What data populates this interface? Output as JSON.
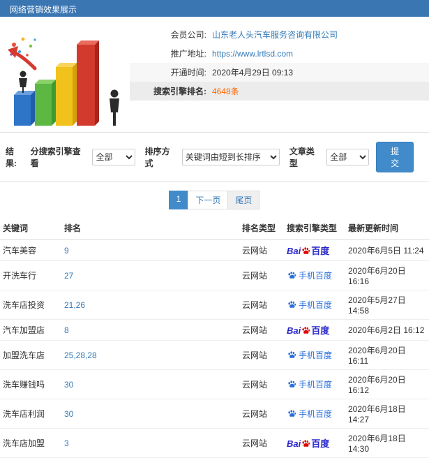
{
  "colors": {
    "titlebar_bg": "#3a76b2",
    "accent": "#428bca",
    "link": "#337ab7",
    "highlight": "#ff6600",
    "baidu_blue": "#2826c9",
    "baidu_red": "#e10602",
    "mobile_baidu_blue": "#2a6fdb"
  },
  "header": {
    "title": "网络营销效果展示"
  },
  "info": {
    "rows": [
      {
        "label": "会员公司:",
        "value": "山东老人头汽车服务咨询有限公司"
      },
      {
        "label": "推广地址:",
        "value": "https://www.lrtlsd.com"
      },
      {
        "label": "开通时间:",
        "value": "2020年4月29日 09:13"
      },
      {
        "label": "搜索引擎排名:",
        "value": "4648条"
      }
    ]
  },
  "filters": {
    "section_label": "结果:",
    "engine_label": "分搜索引擎查看",
    "engine_value": "全部",
    "sort_label": "排序方式",
    "sort_value": "关键词由短到长排序",
    "article_label": "文章类型",
    "article_value": "全部",
    "submit_label": "提交"
  },
  "pagination": {
    "current": "1",
    "next": "下一页",
    "last": "尾页"
  },
  "table": {
    "headers": [
      "关键词",
      "排名",
      "排名类型",
      "搜索引擎类型",
      "最新更新时间"
    ],
    "engine_labels": {
      "baidu_bai": "Bai",
      "baidu_du": "百度",
      "mobile_baidu": "手机百度"
    },
    "rows": [
      {
        "keyword": "汽车美容",
        "rank": "9",
        "rank_type": "云网站",
        "engine": "baidu",
        "updated": "2020年6月5日 11:24"
      },
      {
        "keyword": "开洗车行",
        "rank": "27",
        "rank_type": "云网站",
        "engine": "mobile-baidu",
        "updated": "2020年6月20日 16:16"
      },
      {
        "keyword": "洗车店投资",
        "rank": "21,26",
        "rank_type": "云网站",
        "engine": "mobile-baidu",
        "updated": "2020年5月27日 14:58"
      },
      {
        "keyword": "汽车加盟店",
        "rank": "8",
        "rank_type": "云网站",
        "engine": "baidu",
        "updated": "2020年6月2日 16:12"
      },
      {
        "keyword": "加盟洗车店",
        "rank": "25,28,28",
        "rank_type": "云网站",
        "engine": "mobile-baidu",
        "updated": "2020年6月20日 16:11"
      },
      {
        "keyword": "洗车赚钱吗",
        "rank": "30",
        "rank_type": "云网站",
        "engine": "mobile-baidu",
        "updated": "2020年6月20日 16:12"
      },
      {
        "keyword": "洗车店利润",
        "rank": "30",
        "rank_type": "云网站",
        "engine": "mobile-baidu",
        "updated": "2020年6月18日 14:27"
      },
      {
        "keyword": "洗车店加盟",
        "rank": "3",
        "rank_type": "云网站",
        "engine": "baidu",
        "updated": "2020年6月18日 14:30"
      }
    ]
  }
}
